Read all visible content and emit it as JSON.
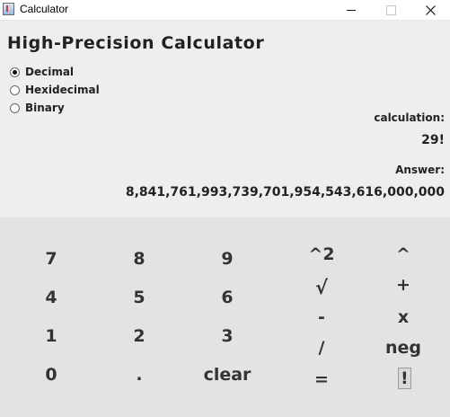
{
  "window": {
    "title": "Calculator",
    "minimize_icon": "minimize-icon",
    "maximize_icon": "maximize-icon",
    "close_icon": "close-icon"
  },
  "header": {
    "title": "High-Precision Calculator"
  },
  "number_mode": {
    "options": [
      "Decimal",
      "Hexidecimal",
      "Binary"
    ],
    "selected": "Decimal"
  },
  "display": {
    "calculation_label": "calculation:",
    "calculation_value": "29!",
    "answer_label": "Answer:",
    "answer_value": "8,841,761,993,739,701,954,543,616,000,000"
  },
  "keys": {
    "seven": "7",
    "eight": "8",
    "nine": "9",
    "four": "4",
    "five": "5",
    "six": "6",
    "one": "1",
    "two": "2",
    "three": "3",
    "zero": "0",
    "dot": ".",
    "clear": "clear",
    "square": "^2",
    "sqrt": "√",
    "minus": "-",
    "divide": "/",
    "equals": "=",
    "power": "^",
    "plus": "+",
    "times": "x",
    "negate": "neg",
    "factorial": "!"
  },
  "colors": {
    "panel_bg": "#eeeeee",
    "keypad_bg": "#e3e3e3",
    "text": "#222222"
  }
}
